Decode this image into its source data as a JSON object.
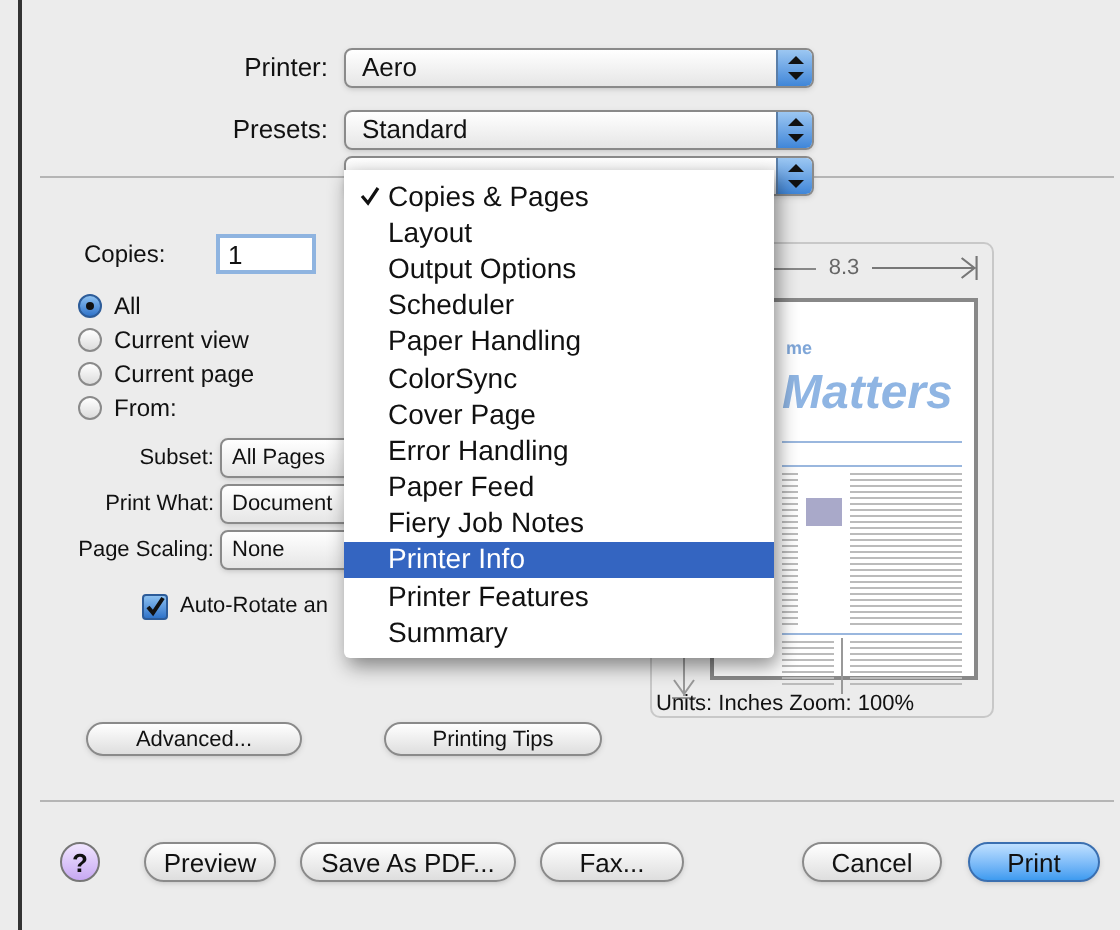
{
  "printer": {
    "label": "Printer:",
    "value": "Aero"
  },
  "presets": {
    "label": "Presets:",
    "value": "Standard"
  },
  "panel_menu": {
    "items": [
      {
        "label": "Copies & Pages",
        "checked": true,
        "selected": false
      },
      {
        "label": "Layout",
        "checked": false,
        "selected": false
      },
      {
        "label": "Output Options",
        "checked": false,
        "selected": false
      },
      {
        "label": "Scheduler",
        "checked": false,
        "selected": false
      },
      {
        "label": "Paper Handling",
        "checked": false,
        "selected": false
      },
      {
        "label": "ColorSync",
        "checked": false,
        "selected": false
      },
      {
        "label": "Cover Page",
        "checked": false,
        "selected": false
      },
      {
        "label": "Error Handling",
        "checked": false,
        "selected": false
      },
      {
        "label": "Paper Feed",
        "checked": false,
        "selected": false
      },
      {
        "label": "Fiery Job Notes",
        "checked": false,
        "selected": false
      },
      {
        "label": "Printer Info",
        "checked": false,
        "selected": true
      },
      {
        "label": "Printer Features",
        "checked": false,
        "selected": false
      },
      {
        "label": "Summary",
        "checked": false,
        "selected": false
      }
    ]
  },
  "copies": {
    "label": "Copies:",
    "value": "1"
  },
  "page_range": [
    {
      "label": "All",
      "selected": true
    },
    {
      "label": "Current view",
      "selected": false
    },
    {
      "label": "Current page",
      "selected": false
    },
    {
      "label": "From:",
      "selected": false
    }
  ],
  "popups": [
    {
      "label": "Subset:",
      "value": "All Pages"
    },
    {
      "label": "Print What:",
      "value": "Document"
    },
    {
      "label": "Page Scaling:",
      "value": "None"
    }
  ],
  "auto_rotate": {
    "label": "Auto-Rotate an",
    "checked": true
  },
  "preview": {
    "width_label": "8.3",
    "logo_small": "me",
    "logo": "Matters",
    "units": "Units: Inches Zoom: 100%"
  },
  "buttons": [
    "Advanced...",
    "Printing Tips"
  ],
  "footer": {
    "help": "?",
    "buttons": [
      {
        "label": "Preview",
        "default": false
      },
      {
        "label": "Save As PDF...",
        "default": false
      },
      {
        "label": "Fax...",
        "default": false
      },
      {
        "label": "Cancel",
        "default": false
      },
      {
        "label": "Print",
        "default": true
      }
    ]
  }
}
